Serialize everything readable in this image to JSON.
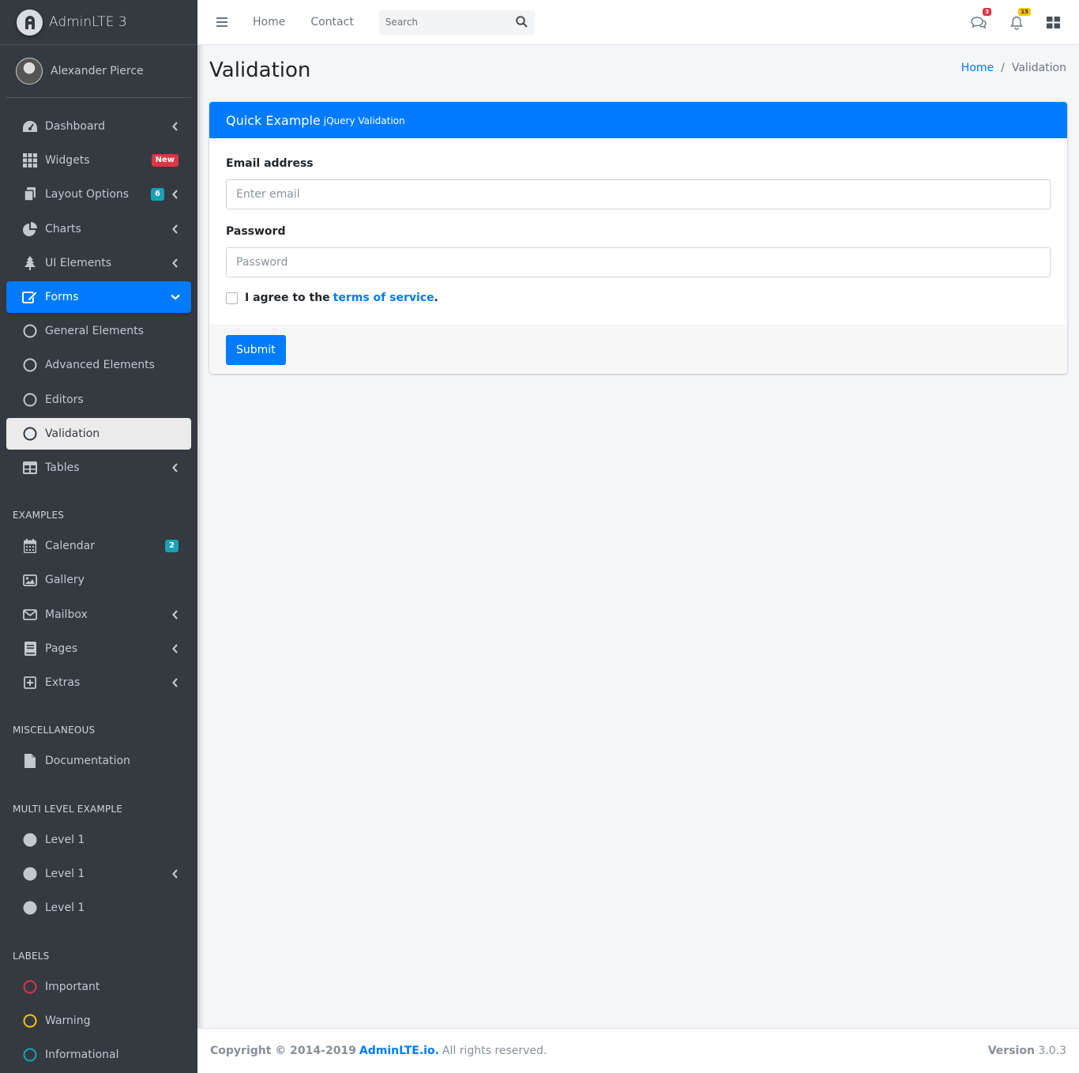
{
  "brand": {
    "text": "AdminLTE 3"
  },
  "user": {
    "name": "Alexander Pierce"
  },
  "sidebar": {
    "items": [
      {
        "label": "Dashboard",
        "icon": "dashboard-icon"
      },
      {
        "label": "Widgets",
        "icon": "widgets-icon",
        "badge": "New"
      },
      {
        "label": "Layout Options",
        "icon": "copy-icon",
        "badge": "6"
      },
      {
        "label": "Charts",
        "icon": "pie-chart-icon"
      },
      {
        "label": "UI Elements",
        "icon": "tree-icon"
      },
      {
        "label": "Forms",
        "icon": "edit-icon"
      },
      {
        "label": "General Elements",
        "icon": "circle-icon"
      },
      {
        "label": "Advanced Elements",
        "icon": "circle-icon"
      },
      {
        "label": "Editors",
        "icon": "circle-icon"
      },
      {
        "label": "Validation",
        "icon": "circle-icon"
      },
      {
        "label": "Tables",
        "icon": "table-icon"
      },
      {
        "label": "Calendar",
        "icon": "calendar-icon",
        "badge": "2"
      },
      {
        "label": "Gallery",
        "icon": "image-icon"
      },
      {
        "label": "Mailbox",
        "icon": "envelope-icon"
      },
      {
        "label": "Pages",
        "icon": "book-icon"
      },
      {
        "label": "Extras",
        "icon": "plus-square-icon"
      },
      {
        "label": "Documentation",
        "icon": "file-icon"
      },
      {
        "label": "Level 1",
        "icon": "circle-filled-icon"
      },
      {
        "label": "Level 1",
        "icon": "circle-filled-icon"
      },
      {
        "label": "Level 1",
        "icon": "circle-filled-icon"
      },
      {
        "label": "Important",
        "icon": "circle-red-icon"
      },
      {
        "label": "Warning",
        "icon": "circle-yellow-icon"
      },
      {
        "label": "Informational",
        "icon": "circle-teal-icon"
      }
    ],
    "headers": [
      "EXAMPLES",
      "MISCELLANEOUS",
      "MULTI LEVEL EXAMPLE",
      "LABELS"
    ]
  },
  "topbar": {
    "home": "Home",
    "contact": "Contact",
    "search_placeholder": "Search",
    "messages_count": "3",
    "notifications_count": "15"
  },
  "page": {
    "title": "Validation",
    "breadcrumb_home": "Home",
    "breadcrumb_current": "Validation"
  },
  "card": {
    "title": "Quick Example",
    "subtitle": "jQuery Validation",
    "email_label": "Email address",
    "email_placeholder": "Enter email",
    "password_label": "Password",
    "password_placeholder": "Password",
    "agree_text": "I agree to the",
    "tos_text": "terms of service",
    "agree_end": ".",
    "submit_label": "Submit"
  },
  "footer": {
    "copyright": "Copyright © 2014-2019",
    "brand_link": "AdminLTE.io.",
    "rights": "All rights reserved.",
    "version_label": "Version",
    "version": "3.0.3"
  },
  "colors": {
    "primary": "#007bff",
    "sidebar_bg": "#343a40",
    "danger": "#dc3545",
    "warning": "#ffc107",
    "info": "#17a2b8"
  }
}
